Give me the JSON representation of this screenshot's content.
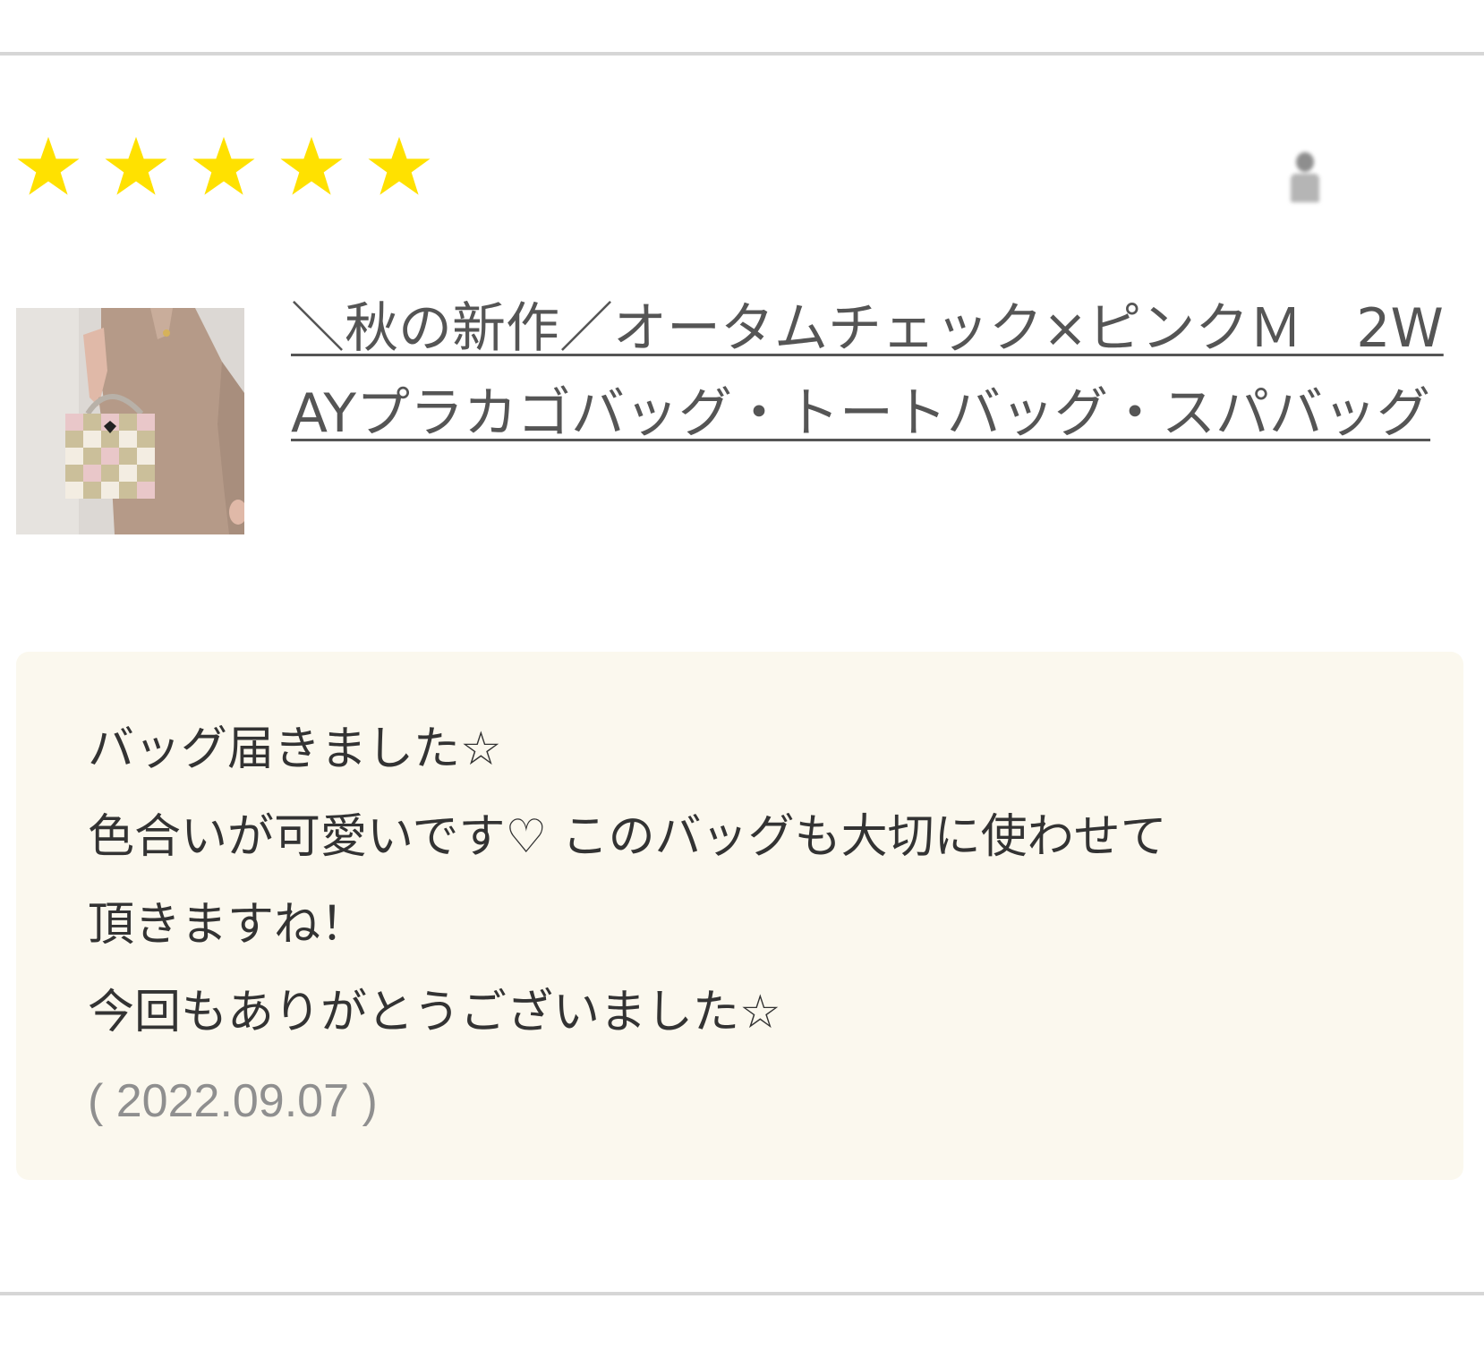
{
  "rating": {
    "stars": 5,
    "max": 5,
    "star_color": "#ffe100"
  },
  "reviewer": {
    "avatar_icon": "user-silhouette-icon",
    "name": ""
  },
  "product": {
    "thumbnail_icon": "product-photo-icon",
    "title": "＼秋の新作／オータムチェック×ピンクＭ　2WAYプラカゴバッグ・トートバッグ・スパバッグ"
  },
  "review": {
    "lines": [
      "バッグ届きました☆",
      "色合いが可愛いです♡ このバッグも大切に使わせて",
      "頂きますね！",
      "今回もありがとうございました☆"
    ],
    "date": "( 2022.09.07 )"
  },
  "colors": {
    "review_background": "#fbf8ee",
    "divider": "#d6d6d6",
    "link_text": "#555555",
    "date_text": "#8f8f8f"
  }
}
